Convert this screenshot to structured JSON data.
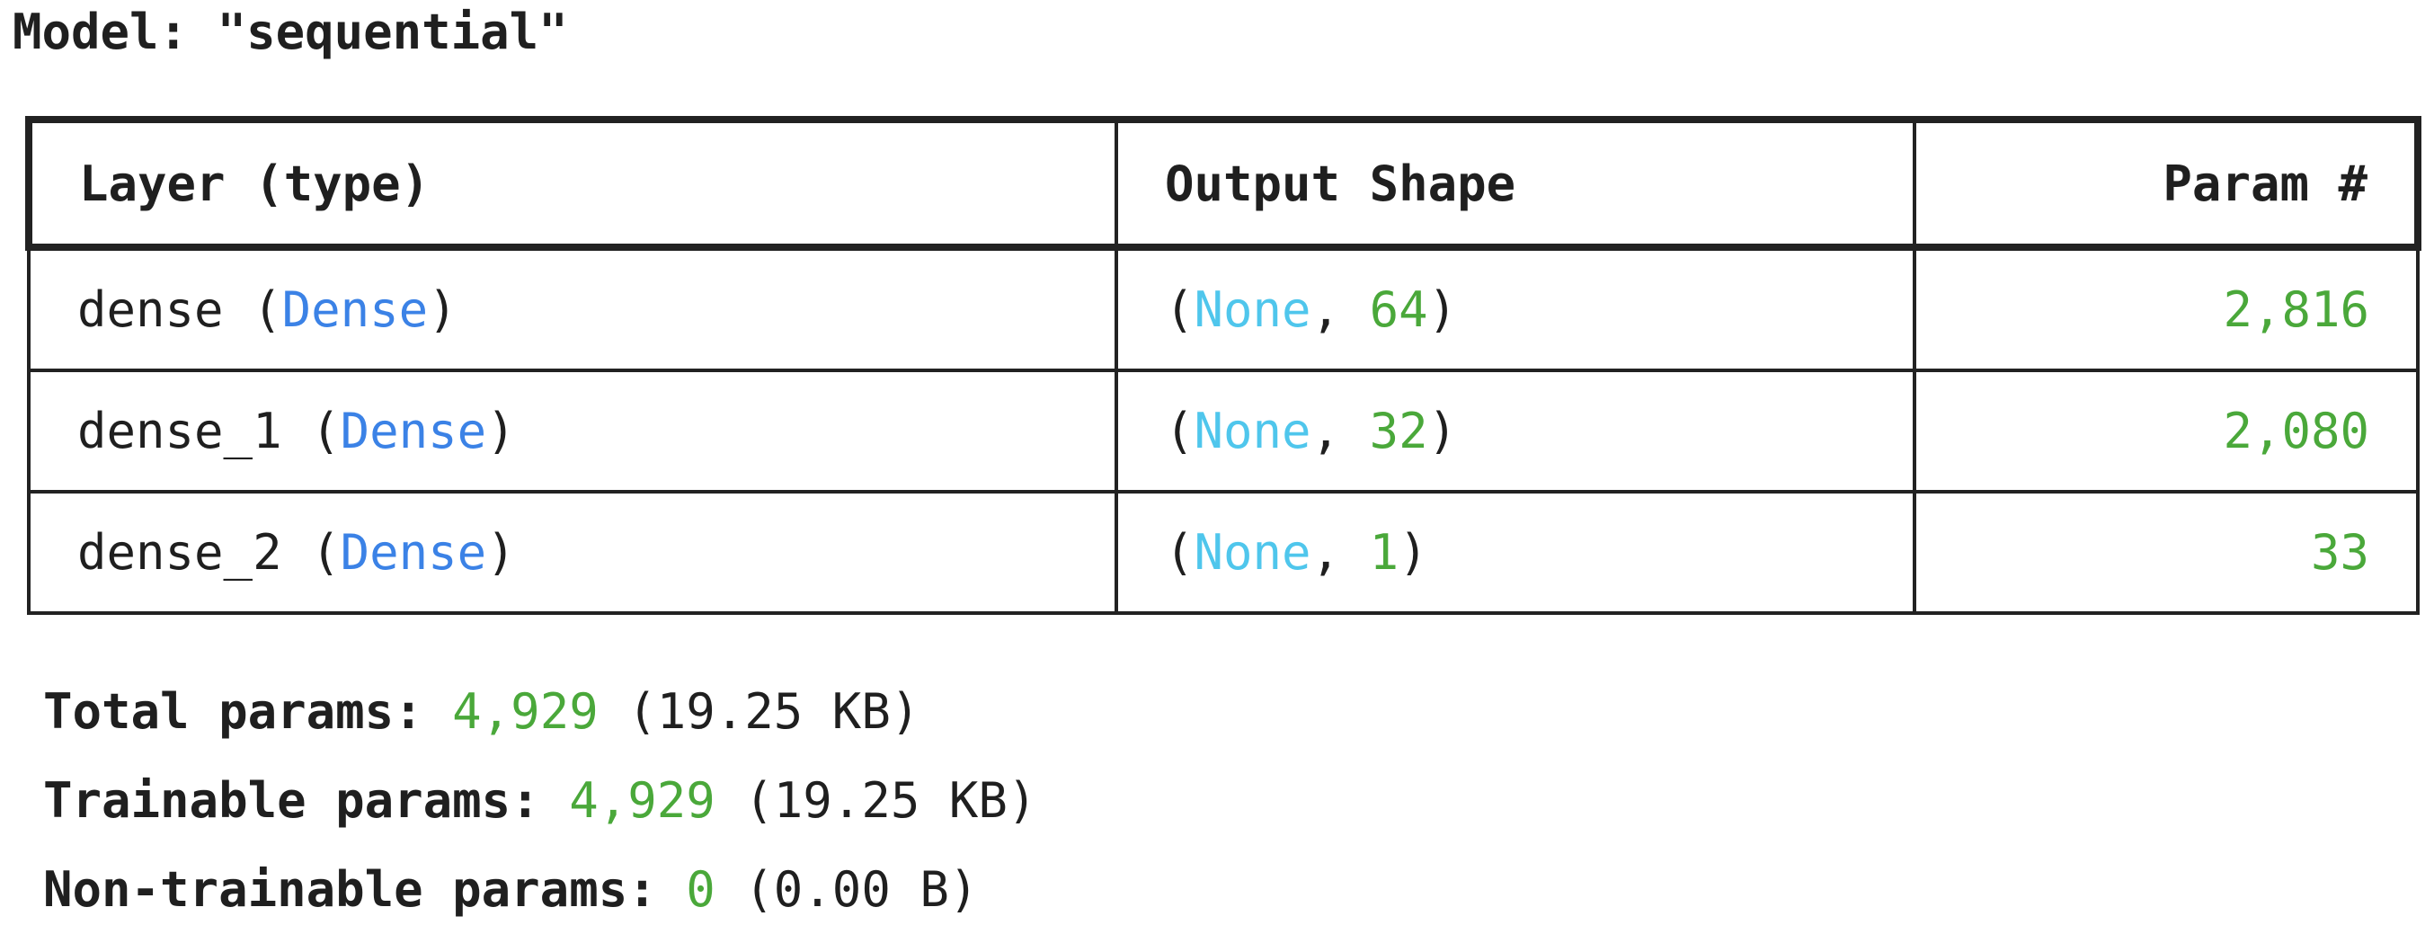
{
  "model": {
    "title_prefix": "Model: ",
    "name": "\"sequential\""
  },
  "table": {
    "headers": {
      "layer": "Layer (type)",
      "shape": "Output Shape",
      "params": "Param #"
    },
    "rows": [
      {
        "layer_name": "dense",
        "layer_type": "Dense",
        "shape_first": "None",
        "shape_units": "64",
        "params": "2,816"
      },
      {
        "layer_name": "dense_1",
        "layer_type": "Dense",
        "shape_first": "None",
        "shape_units": "32",
        "params": "2,080"
      },
      {
        "layer_name": "dense_2",
        "layer_type": "Dense",
        "shape_first": "None",
        "shape_units": "1",
        "params": "33"
      }
    ]
  },
  "totals": {
    "total": {
      "label": "Total params: ",
      "count": "4,929",
      "size": " (19.25 KB)"
    },
    "trainable": {
      "label": "Trainable params: ",
      "count": "4,929",
      "size": " (19.25 KB)"
    },
    "non_trainable": {
      "label": "Non-trainable params: ",
      "count": "0",
      "size": " (0.00 B)"
    }
  },
  "colors": {
    "layer_type": "#3b82e6",
    "none": "#4fc6ec",
    "number": "#4aa83a",
    "text": "#1f1f1f"
  }
}
